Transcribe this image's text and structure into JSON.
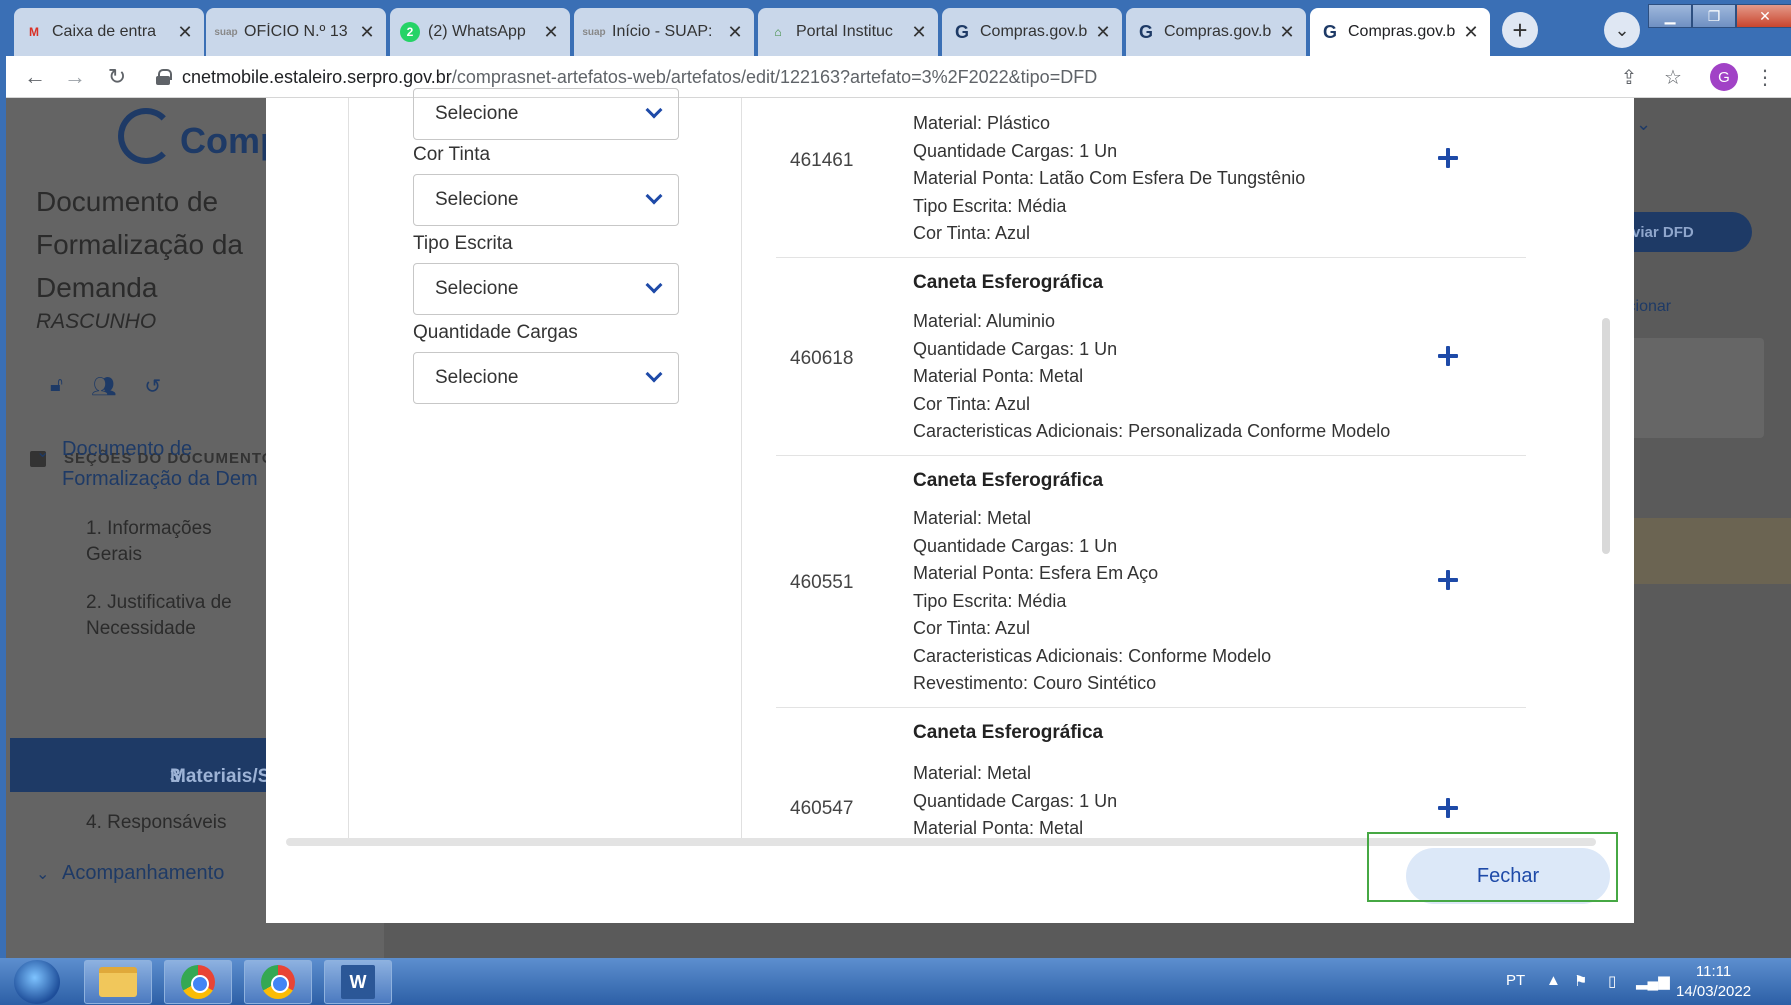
{
  "browser": {
    "tabs": [
      {
        "icon": "gmail-icon",
        "title": "Caixa de entra",
        "active": false
      },
      {
        "icon": "suap-icon",
        "title": "OFÍCIO N.º 13",
        "active": false
      },
      {
        "icon": "whatsapp-icon",
        "title": "(2) WhatsApp",
        "badge": "2",
        "active": false
      },
      {
        "icon": "suap-icon",
        "title": "Início - SUAP:",
        "active": false
      },
      {
        "icon": "portal-icon",
        "title": "Portal Instituc",
        "active": false
      },
      {
        "icon": "compras-icon",
        "title": "Compras.gov.b",
        "active": false
      },
      {
        "icon": "compras-icon",
        "title": "Compras.gov.b",
        "active": false
      },
      {
        "icon": "compras-icon",
        "title": "Compras.gov.b",
        "active": true
      }
    ],
    "url_host": "cnetmobile.estaleiro.serpro.gov.br",
    "url_path": "/comprasnet-artefatos-web/artefatos/edit/122163?artefato=3%2F2022&tipo=DFD",
    "profile_initial": "G"
  },
  "page": {
    "logo_text": "Comp",
    "doc_title": "Documento de Formalização da Demanda",
    "doc_status": "RASCUNHO",
    "sections_header": "SEÇÕES DO DOCUMENTO",
    "tree_root": "Documento de Formalização da Dem",
    "sections": [
      {
        "num": "1.",
        "label": "Informações Gerais"
      },
      {
        "num": "2.",
        "label": "Justificativa de Necessidade"
      },
      {
        "num": "3.",
        "label": "Materiais/Servi"
      },
      {
        "num": "4.",
        "label": "Responsáveis"
      }
    ],
    "acompanhamento": "Acompanhamento",
    "send_button": "viar DFD",
    "add_link": "icionar"
  },
  "modal": {
    "filters": [
      {
        "label": "",
        "value": "Selecione"
      },
      {
        "label": "Cor Tinta",
        "value": "Selecione"
      },
      {
        "label": "Tipo Escrita",
        "value": "Selecione"
      },
      {
        "label": "Quantidade Cargas",
        "value": "Selecione"
      }
    ],
    "results": [
      {
        "code": "461461",
        "title": "",
        "attributes": [
          "Material: Plástico",
          "Quantidade Cargas: 1 Un",
          "Material Ponta: Latão Com Esfera De Tungstênio",
          "Tipo Escrita: Média",
          "Cor Tinta: Azul"
        ]
      },
      {
        "code": "460618",
        "title": "Caneta Esferográfica",
        "attributes": [
          "Material: Aluminio",
          "Quantidade Cargas: 1 Un",
          "Material Ponta: Metal",
          "Cor Tinta: Azul",
          "Caracteristicas Adicionais: Personalizada Conforme Modelo"
        ]
      },
      {
        "code": "460551",
        "title": "Caneta Esferográfica",
        "attributes": [
          "Material: Metal",
          "Quantidade Cargas: 1 Un",
          "Material Ponta: Esfera Em Aço",
          "Tipo Escrita: Média",
          "Cor Tinta: Azul",
          "Caracteristicas Adicionais: Conforme Modelo",
          "Revestimento: Couro Sintético"
        ]
      },
      {
        "code": "460547",
        "title": "Caneta Esferográfica",
        "attributes": [
          "Material: Metal",
          "Quantidade Cargas: 1 Un",
          "Material Ponta: Metal"
        ]
      }
    ],
    "close_label": "Fechar"
  },
  "taskbar": {
    "language": "PT",
    "time": "11:11",
    "date": "14/03/2022"
  },
  "colors": {
    "accent": "#1e4aa8",
    "highlight": "#46a844",
    "sidebar_active": "#1e3a66"
  }
}
